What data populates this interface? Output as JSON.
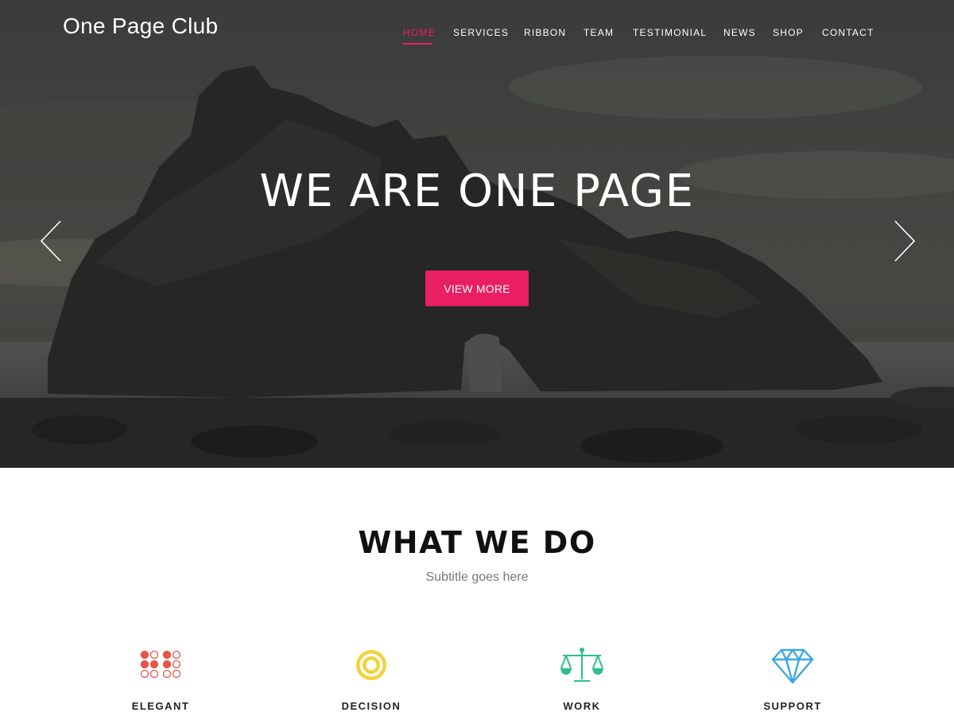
{
  "brand": {
    "name": "One Page Club"
  },
  "nav": {
    "items": [
      {
        "label": "HOME",
        "active": true
      },
      {
        "label": "SERVICES",
        "active": false
      },
      {
        "label": "RIBBON",
        "active": false
      },
      {
        "label": "TEAM",
        "active": false
      },
      {
        "label": "TESTIMONIAL",
        "active": false
      },
      {
        "label": "NEWS",
        "active": false
      },
      {
        "label": "SHOP",
        "active": false
      },
      {
        "label": "CONTACT",
        "active": false
      }
    ]
  },
  "hero": {
    "title": "WE ARE ONE PAGE",
    "button_label": "VIEW MORE",
    "prev_icon": "chevron-left-icon",
    "next_icon": "chevron-right-icon"
  },
  "services": {
    "title": "WHAT WE DO",
    "subtitle": "Subtitle goes here",
    "features": [
      {
        "label": "ELEGANT",
        "icon": "dots-grid-icon",
        "color": "#e8544a"
      },
      {
        "label": "DECISION",
        "icon": "target-icon",
        "color": "#f2d23c"
      },
      {
        "label": "WORK",
        "icon": "scales-icon",
        "color": "#2fbf8a"
      },
      {
        "label": "SUPPORT",
        "icon": "diamond-icon",
        "color": "#3aa8e0"
      }
    ]
  },
  "colors": {
    "accent": "#e91e63"
  }
}
